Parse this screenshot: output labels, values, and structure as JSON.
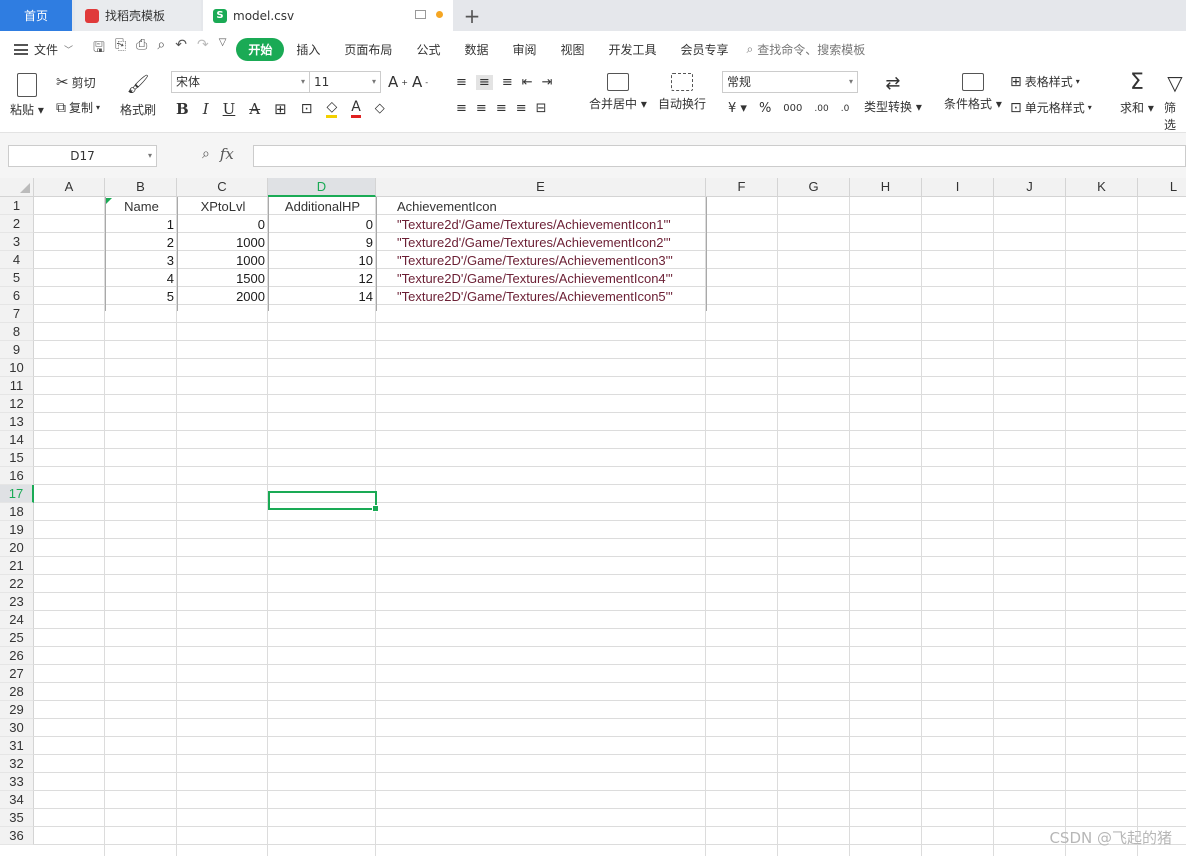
{
  "tabs": {
    "home": "首页",
    "doc": "找稻壳模板",
    "active": "model.csv",
    "add": "+"
  },
  "menubar": {
    "file": "文件",
    "items": [
      "开始",
      "插入",
      "页面布局",
      "公式",
      "数据",
      "审阅",
      "视图",
      "开发工具",
      "会员专享"
    ],
    "search": "查找命令、搜索模板"
  },
  "ribbon": {
    "paste": "粘贴",
    "cut": "剪切",
    "copy": "复制",
    "format_painter": "格式刷",
    "font_name": "宋体",
    "font_size": "11",
    "merge_center": "合并居中",
    "wrap": "自动换行",
    "number_format": "常规",
    "type_convert": "类型转换",
    "cond_format": "条件格式",
    "table_style": "表格样式",
    "cell_style": "单元格样式",
    "sum": "求和",
    "filter": "筛选"
  },
  "formula_bar": {
    "name_box": "D17",
    "fx": "fx",
    "value": ""
  },
  "sheet": {
    "columns": [
      "A",
      "B",
      "C",
      "D",
      "E",
      "F",
      "G",
      "H",
      "I",
      "J",
      "K",
      "L"
    ],
    "selected_column": "D",
    "selected_row": "17",
    "rows": [
      "1",
      "2",
      "3",
      "4",
      "5",
      "6",
      "7",
      "8",
      "9",
      "10",
      "11",
      "12",
      "13",
      "14",
      "15",
      "16",
      "17",
      "18",
      "19",
      "20",
      "21",
      "22",
      "23",
      "24",
      "25",
      "26",
      "27",
      "28",
      "29",
      "30",
      "31",
      "32",
      "33",
      "34",
      "35",
      "36"
    ],
    "header": [
      "Name",
      "XPtoLvl",
      "AdditionalHP",
      "AchievementIcon"
    ],
    "data": [
      [
        "1",
        "0",
        "0",
        "\"Texture2d'/Game/Textures/AchievementIcon1'\""
      ],
      [
        "2",
        "1000",
        "9",
        "\"Texture2d'/Game/Textures/AchievementIcon2'\""
      ],
      [
        "3",
        "1000",
        "10",
        "\"Texture2D'/Game/Textures/AchievementIcon3'\""
      ],
      [
        "4",
        "1500",
        "12",
        "\"Texture2D'/Game/Textures/AchievementIcon4'\""
      ],
      [
        "5",
        "2000",
        "14",
        "\"Texture2D'/Game/Textures/AchievementIcon5'\""
      ]
    ]
  },
  "watermark": "CSDN @飞起的猪",
  "colors": {
    "accent_green": "#1aaa55",
    "home_tab_blue": "#2f7de1",
    "path_text": "#6b1f34"
  }
}
